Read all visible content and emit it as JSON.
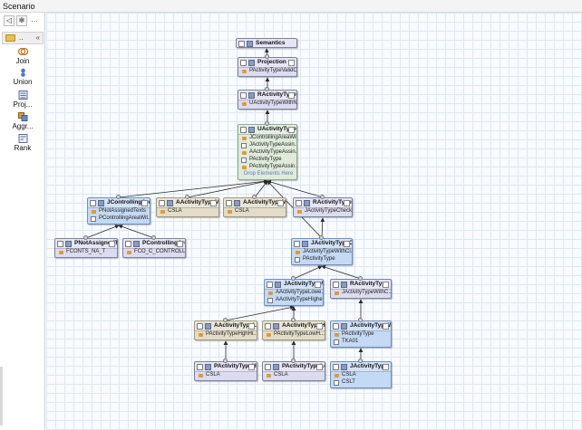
{
  "window": {
    "title": "Scenario"
  },
  "palette": {
    "tools": [
      {
        "icon": "back-arrow-icon",
        "label": "◁"
      },
      {
        "icon": "gear-icon",
        "label": "✻"
      },
      {
        "icon": "menu-icon",
        "label": "…"
      }
    ],
    "folder": {
      "label": "..",
      "icon": "folder-icon",
      "close": "«"
    },
    "items": [
      {
        "label": "Join",
        "icon": "join-icon"
      },
      {
        "label": "Union",
        "icon": "union-icon"
      },
      {
        "label": "Proj...",
        "icon": "projection-icon"
      },
      {
        "label": "Aggr...",
        "icon": "aggregation-icon"
      },
      {
        "label": "Rank",
        "icon": "rank-icon"
      }
    ]
  },
  "nodes": [
    {
      "id": "semantics",
      "title": "Semantics",
      "color": "lav",
      "rows": []
    },
    {
      "id": "projection",
      "title": "Projection",
      "color": "lav",
      "rows": [
        "PActivityTypeValidO..."
      ]
    },
    {
      "id": "rvalid",
      "title": "RActivityTypeValid...",
      "color": "lav",
      "rows": [
        "UActivityTypeWithN..."
      ]
    },
    {
      "id": "uwith",
      "title": "UActivityTypeWith...",
      "color": "green",
      "rows": [
        "JControllingAreaWit...",
        "JActivityTypeAssin...",
        "AActivityTypeAssin...",
        "PActivityType",
        "PActivityTypeAssin..."
      ],
      "drop": "Drop Elements Here"
    },
    {
      "id": "jctrl",
      "title": "JControllingAreaW...",
      "color": "blue",
      "rows": [
        "PNotAssignedTexts",
        "PControllingAreaWit..."
      ]
    },
    {
      "id": "amis1",
      "title": "AActivityTypeMis...",
      "color": "tan",
      "rows": [
        "CSLA"
      ]
    },
    {
      "id": "amis2",
      "title": "AActivityTypeMis...",
      "color": "tan",
      "rows": [
        "CSLA"
      ]
    },
    {
      "id": "rmis",
      "title": "RActivityTypeMis...",
      "color": "lav",
      "rows": [
        "JActivityTypeCheck..."
      ]
    },
    {
      "id": "pnot",
      "title": "PNotAssignedText",
      "color": "lav",
      "rows": [
        "FCONTS_NA_T"
      ]
    },
    {
      "id": "pctrl",
      "title": "PControllingArea...",
      "color": "lav",
      "rows": [
        "FCO_C_CONTROLL"
      ]
    },
    {
      "id": "jcheck",
      "title": "JActivityTypeChe...",
      "color": "blue",
      "rows": [
        "JActivityTypeWithCl...",
        "PActivityType"
      ]
    },
    {
      "id": "jwith",
      "title": "JActivityTypeWith...",
      "color": "blue",
      "rows": [
        "AActivityTypeLowe...",
        "AActivityTypeHighe..."
      ]
    },
    {
      "id": "rwith",
      "title": "RActivityType",
      "color": "lav",
      "rows": [
        "JActivityTypeWithC..."
      ]
    },
    {
      "id": "alow",
      "title": "AActivityTypeLow...",
      "color": "tan",
      "rows": [
        "PActivityTypeHghHi..."
      ]
    },
    {
      "id": "ahigh",
      "title": "AActivityTypeHigh...",
      "color": "tan",
      "rows": [
        "PActivityTypeLowH..."
      ]
    },
    {
      "id": "jtype",
      "title": "JActivityTypeWith...",
      "color": "blue",
      "rows": [
        "PActivityType",
        "TKA01"
      ]
    },
    {
      "id": "phigh",
      "title": "PActivityTypeHigh...",
      "color": "lav",
      "rows": [
        "CSLA"
      ]
    },
    {
      "id": "plow",
      "title": "PActivityTypeLow...",
      "color": "lav",
      "rows": [
        "CSLA"
      ]
    },
    {
      "id": "jtype2",
      "title": "JActivityType",
      "color": "blue",
      "rows": [
        "CSLA",
        "CSLT"
      ]
    }
  ],
  "colors": {
    "edge": "#2a2a2a",
    "grid": "#dfe7f1",
    "canvas": "#f8fbff"
  }
}
